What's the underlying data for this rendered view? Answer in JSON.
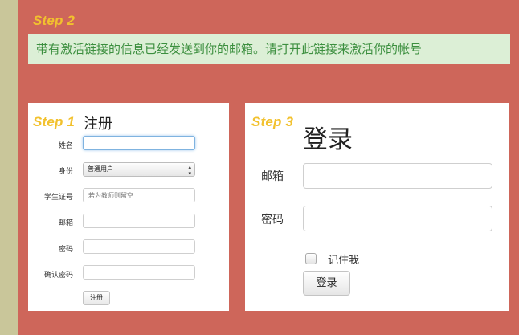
{
  "step2": {
    "label": "Step 2",
    "message": "带有激活链接的信息已经发送到你的邮箱。请打开此链接来激活你的帐号"
  },
  "register": {
    "step_label": "Step 1",
    "title": "注册",
    "name_label": "姓名",
    "identity_label": "身份",
    "identity_selected": "普通用户",
    "student_id_label": "学生证号",
    "student_id_placeholder": "若为教师则留空",
    "email_label": "邮箱",
    "password_label": "密码",
    "confirm_password_label": "确认密码",
    "submit_label": "注册"
  },
  "login": {
    "step_label": "Step 3",
    "title": "登录",
    "email_label": "邮箱",
    "password_label": "密码",
    "remember_label": "记住我",
    "submit_label": "登录"
  },
  "colors": {
    "background": "#ce665a",
    "side_strip": "#c9c69a",
    "step_label": "#f2c12e",
    "notice_bg": "#dcefd6",
    "notice_text": "#3c8f3f"
  }
}
